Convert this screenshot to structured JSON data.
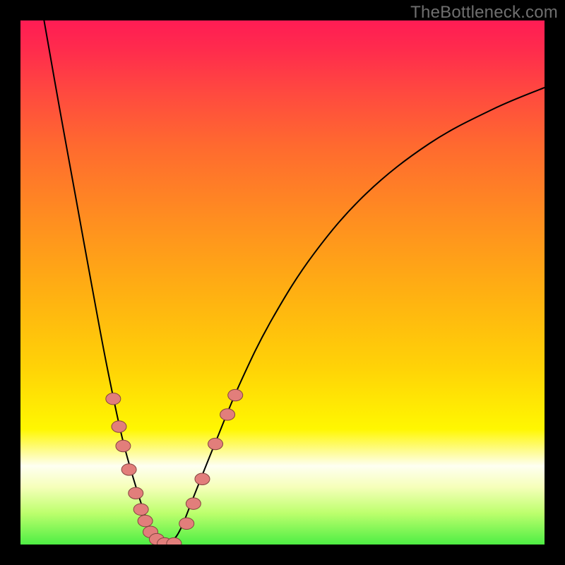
{
  "attribution": "TheBottleneck.com",
  "colors": {
    "frame_bg_gradient_stops": [
      "#ff1c54",
      "#ff2d4c",
      "#ff4a3f",
      "#ff6a2f",
      "#ff8e20",
      "#ffb012",
      "#ffd207",
      "#fff701",
      "#fefff1",
      "#f6ffba",
      "#bdff6d",
      "#4eee44"
    ],
    "curve_stroke": "#000000",
    "marker_fill": "#e27e7b",
    "marker_stroke": "#84443f",
    "page_bg": "#000000",
    "attribution_text": "#6f6f6f"
  },
  "chart_data": {
    "type": "line",
    "title": "",
    "xlabel": "",
    "ylabel": "",
    "x_range": [
      0,
      1
    ],
    "y_range": [
      0,
      1
    ],
    "y_axis_inverted_on_screen": true,
    "series": [
      {
        "name": "left-curve",
        "x": [
          0.045,
          0.075,
          0.105,
          0.135,
          0.165,
          0.195,
          0.225,
          0.248,
          0.263,
          0.278
        ],
        "y": [
          1.0,
          0.83,
          0.665,
          0.5,
          0.34,
          0.2,
          0.095,
          0.03,
          0.01,
          0.0
        ]
      },
      {
        "name": "right-curve",
        "x": [
          0.278,
          0.293,
          0.308,
          0.33,
          0.37,
          0.42,
          0.48,
          0.56,
          0.66,
          0.78,
          0.9,
          1.0
        ],
        "y": [
          0.0,
          0.01,
          0.035,
          0.09,
          0.19,
          0.31,
          0.43,
          0.555,
          0.67,
          0.765,
          0.83,
          0.872
        ]
      }
    ],
    "markers": [
      {
        "series": "left-curve",
        "x": 0.177,
        "y": 0.278
      },
      {
        "series": "left-curve",
        "x": 0.188,
        "y": 0.225
      },
      {
        "series": "left-curve",
        "x": 0.196,
        "y": 0.188
      },
      {
        "series": "left-curve",
        "x": 0.207,
        "y": 0.143
      },
      {
        "series": "left-curve",
        "x": 0.22,
        "y": 0.098
      },
      {
        "series": "left-curve",
        "x": 0.23,
        "y": 0.067
      },
      {
        "series": "left-curve",
        "x": 0.238,
        "y": 0.045
      },
      {
        "series": "left-curve",
        "x": 0.248,
        "y": 0.024
      },
      {
        "series": "left-curve",
        "x": 0.26,
        "y": 0.01
      },
      {
        "series": "left-curve",
        "x": 0.275,
        "y": 0.002
      },
      {
        "series": "left-curve",
        "x": 0.293,
        "y": 0.002
      },
      {
        "series": "right-curve",
        "x": 0.317,
        "y": 0.04
      },
      {
        "series": "right-curve",
        "x": 0.33,
        "y": 0.078
      },
      {
        "series": "right-curve",
        "x": 0.347,
        "y": 0.125
      },
      {
        "series": "right-curve",
        "x": 0.372,
        "y": 0.192
      },
      {
        "series": "right-curve",
        "x": 0.395,
        "y": 0.248
      },
      {
        "series": "right-curve",
        "x": 0.41,
        "y": 0.285
      }
    ],
    "marker_radius": 10
  }
}
